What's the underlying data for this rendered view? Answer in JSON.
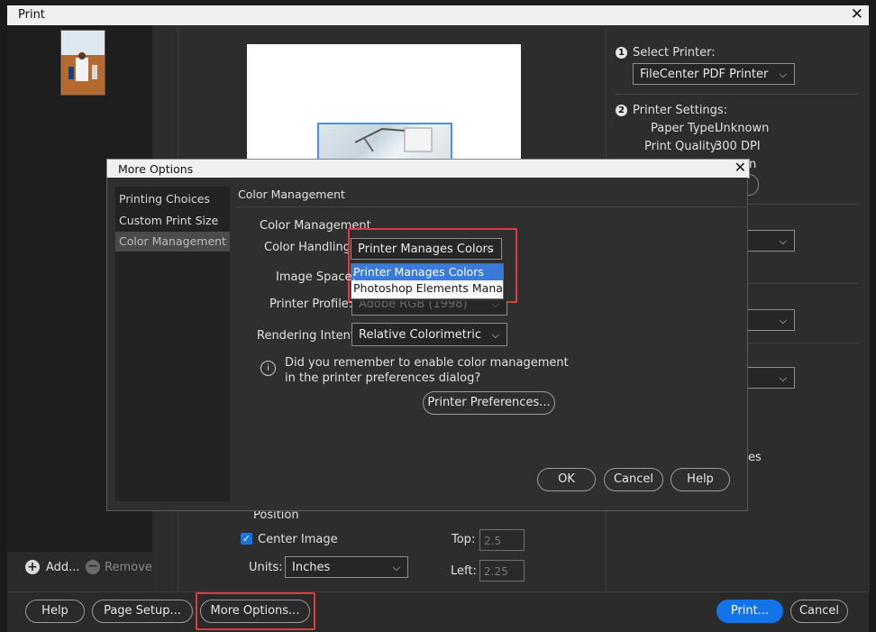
{
  "window": {
    "title": "Print",
    "close": "✕"
  },
  "left_panel": {
    "add_label": "Add...",
    "remove_label": "Remove"
  },
  "right_panel": {
    "select_printer": {
      "step": "1",
      "label": "Select Printer:",
      "value": "FileCenter PDF Printer"
    },
    "printer_settings": {
      "step": "2",
      "label": "Printer Settings:",
      "paper_type_label": "Paper Type:",
      "paper_type_value": "Unknown",
      "print_quality_label": "Print Quality:",
      "print_quality_value": "300 DPI",
      "partial_n": "n",
      "partial_es": "es"
    }
  },
  "position": {
    "heading": "Position",
    "center_image_label": "Center Image",
    "center_image_checked": true,
    "units_label": "Units:",
    "units_value": "Inches",
    "top_label": "Top:",
    "top_value": "2.5",
    "left_label": "Left:",
    "left_value": "2.25"
  },
  "bottom_bar": {
    "help": "Help",
    "page_setup": "Page Setup...",
    "more_options": "More Options...",
    "print": "Print...",
    "cancel": "Cancel"
  },
  "more_options": {
    "title": "More Options",
    "close": "✕",
    "sidebar": [
      "Printing Choices",
      "Custom Print Size",
      "Color Management"
    ],
    "selected_section": "Color Management",
    "section_title": "Color Management",
    "group_title": "Color Management",
    "color_handling_label": "Color Handling:",
    "color_handling_value": "Printer Manages Colors",
    "color_handling_options": [
      "Printer Manages Colors",
      "Photoshop Elements Manag..."
    ],
    "image_space_label": "Image Space:",
    "printer_profile_label": "Printer Profile:",
    "printer_profile_value": "Adobe RGB (1998)",
    "rendering_intent_label": "Rendering Intent:",
    "rendering_intent_value": "Relative Colorimetric",
    "info_line1": "Did you remember to enable color management",
    "info_line2": "in the printer preferences dialog?",
    "printer_preferences_button": "Printer Preferences...",
    "ok": "OK",
    "cancel": "Cancel",
    "help": "Help"
  },
  "colors": {
    "accent": "#1473e6",
    "highlight": "#e0393e",
    "dropdown_selection": "#3b7ad9"
  }
}
